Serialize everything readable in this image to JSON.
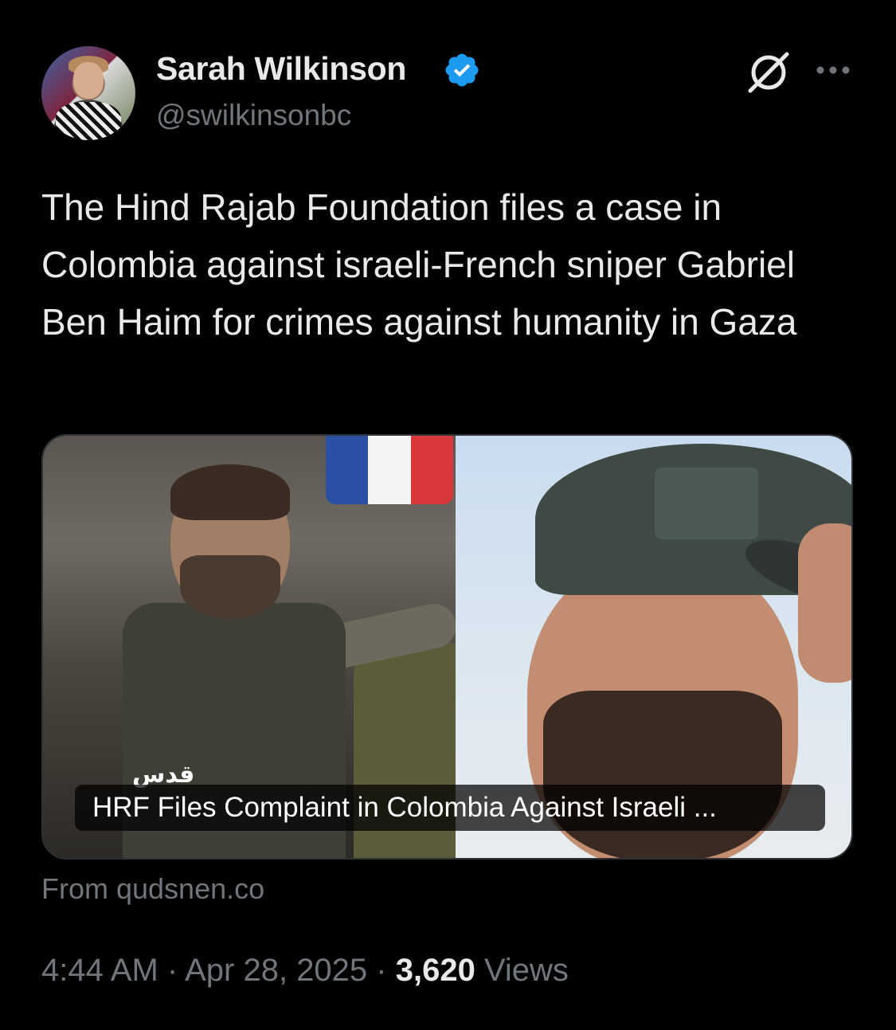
{
  "author": {
    "name": "Sarah Wilkinson",
    "handle": "@swilkinsonbc",
    "verified": true,
    "verified_color": "#1d9bf0"
  },
  "header_icons": [
    "grok-icon",
    "more-icon"
  ],
  "tweet": {
    "text": "The Hind Rajab Foundation files a case in Colombia against israeli-French sniper Gabriel Ben Haim for crimes against humanity in Gaza"
  },
  "card": {
    "watermark": "قدس",
    "caption": "HRF Files Complaint in Colombia Against Israeli ...",
    "source": "From qudsnen.co"
  },
  "meta": {
    "time": "4:44 AM",
    "separator": " · ",
    "date": "Apr 28, 2025",
    "views_count": "3,620",
    "views_label": "Views"
  },
  "colors": {
    "background": "#000000",
    "text": "#e7e9ea",
    "secondary_text": "#71767b",
    "border": "#2f3336"
  }
}
